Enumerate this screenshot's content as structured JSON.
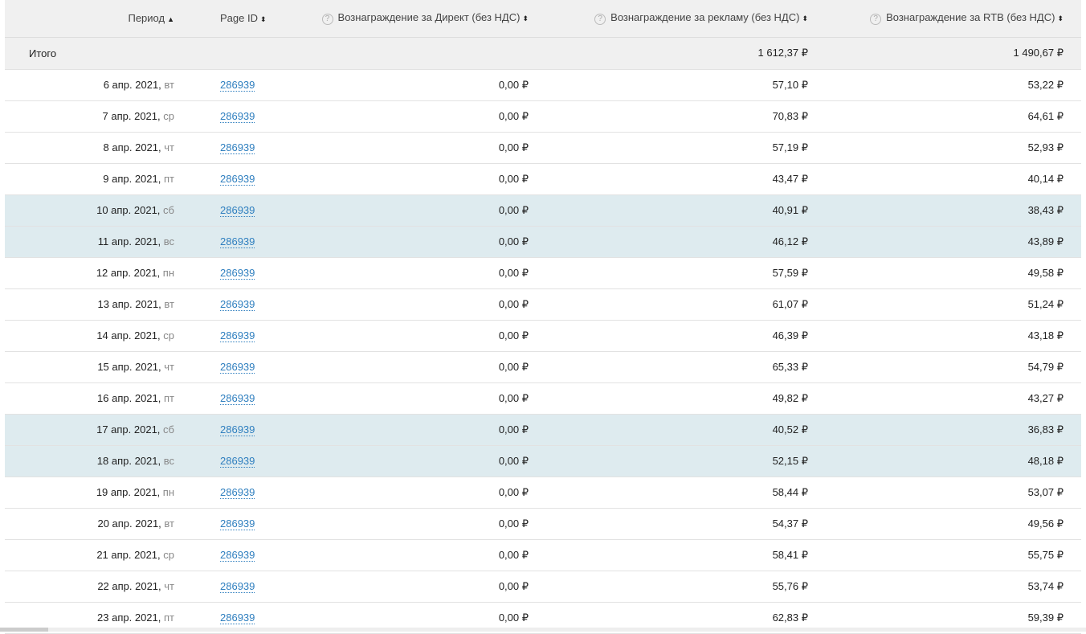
{
  "headers": {
    "period": "Период",
    "page_id": "Page ID",
    "direct": "Вознаграждение за Директ (без НДС)",
    "ads": "Вознаграждение за рекламу (без НДС)",
    "rtb": "Вознаграждение за RTB (без НДС)",
    "sort_asc": "▲",
    "sort_both": "⬍",
    "help": "?"
  },
  "total": {
    "label": "Итого",
    "ads": "1 612,37 ₽",
    "rtb": "1 490,67 ₽"
  },
  "rows": [
    {
      "date": "6 апр. 2021,",
      "dow": "вт",
      "id": "286939",
      "direct": "0,00 ₽",
      "ads": "57,10 ₽",
      "rtb": "53,22 ₽",
      "weekend": false
    },
    {
      "date": "7 апр. 2021,",
      "dow": "ср",
      "id": "286939",
      "direct": "0,00 ₽",
      "ads": "70,83 ₽",
      "rtb": "64,61 ₽",
      "weekend": false
    },
    {
      "date": "8 апр. 2021,",
      "dow": "чт",
      "id": "286939",
      "direct": "0,00 ₽",
      "ads": "57,19 ₽",
      "rtb": "52,93 ₽",
      "weekend": false
    },
    {
      "date": "9 апр. 2021,",
      "dow": "пт",
      "id": "286939",
      "direct": "0,00 ₽",
      "ads": "43,47 ₽",
      "rtb": "40,14 ₽",
      "weekend": false
    },
    {
      "date": "10 апр. 2021,",
      "dow": "сб",
      "id": "286939",
      "direct": "0,00 ₽",
      "ads": "40,91 ₽",
      "rtb": "38,43 ₽",
      "weekend": true
    },
    {
      "date": "11 апр. 2021,",
      "dow": "вс",
      "id": "286939",
      "direct": "0,00 ₽",
      "ads": "46,12 ₽",
      "rtb": "43,89 ₽",
      "weekend": true
    },
    {
      "date": "12 апр. 2021,",
      "dow": "пн",
      "id": "286939",
      "direct": "0,00 ₽",
      "ads": "57,59 ₽",
      "rtb": "49,58 ₽",
      "weekend": false
    },
    {
      "date": "13 апр. 2021,",
      "dow": "вт",
      "id": "286939",
      "direct": "0,00 ₽",
      "ads": "61,07 ₽",
      "rtb": "51,24 ₽",
      "weekend": false
    },
    {
      "date": "14 апр. 2021,",
      "dow": "ср",
      "id": "286939",
      "direct": "0,00 ₽",
      "ads": "46,39 ₽",
      "rtb": "43,18 ₽",
      "weekend": false
    },
    {
      "date": "15 апр. 2021,",
      "dow": "чт",
      "id": "286939",
      "direct": "0,00 ₽",
      "ads": "65,33 ₽",
      "rtb": "54,79 ₽",
      "weekend": false
    },
    {
      "date": "16 апр. 2021,",
      "dow": "пт",
      "id": "286939",
      "direct": "0,00 ₽",
      "ads": "49,82 ₽",
      "rtb": "43,27 ₽",
      "weekend": false
    },
    {
      "date": "17 апр. 2021,",
      "dow": "сб",
      "id": "286939",
      "direct": "0,00 ₽",
      "ads": "40,52 ₽",
      "rtb": "36,83 ₽",
      "weekend": true
    },
    {
      "date": "18 апр. 2021,",
      "dow": "вс",
      "id": "286939",
      "direct": "0,00 ₽",
      "ads": "52,15 ₽",
      "rtb": "48,18 ₽",
      "weekend": true
    },
    {
      "date": "19 апр. 2021,",
      "dow": "пн",
      "id": "286939",
      "direct": "0,00 ₽",
      "ads": "58,44 ₽",
      "rtb": "53,07 ₽",
      "weekend": false
    },
    {
      "date": "20 апр. 2021,",
      "dow": "вт",
      "id": "286939",
      "direct": "0,00 ₽",
      "ads": "54,37 ₽",
      "rtb": "49,56 ₽",
      "weekend": false
    },
    {
      "date": "21 апр. 2021,",
      "dow": "ср",
      "id": "286939",
      "direct": "0,00 ₽",
      "ads": "58,41 ₽",
      "rtb": "55,75 ₽",
      "weekend": false
    },
    {
      "date": "22 апр. 2021,",
      "dow": "чт",
      "id": "286939",
      "direct": "0,00 ₽",
      "ads": "55,76 ₽",
      "rtb": "53,74 ₽",
      "weekend": false
    },
    {
      "date": "23 апр. 2021,",
      "dow": "пт",
      "id": "286939",
      "direct": "0,00 ₽",
      "ads": "62,83 ₽",
      "rtb": "59,39 ₽",
      "weekend": false
    }
  ]
}
